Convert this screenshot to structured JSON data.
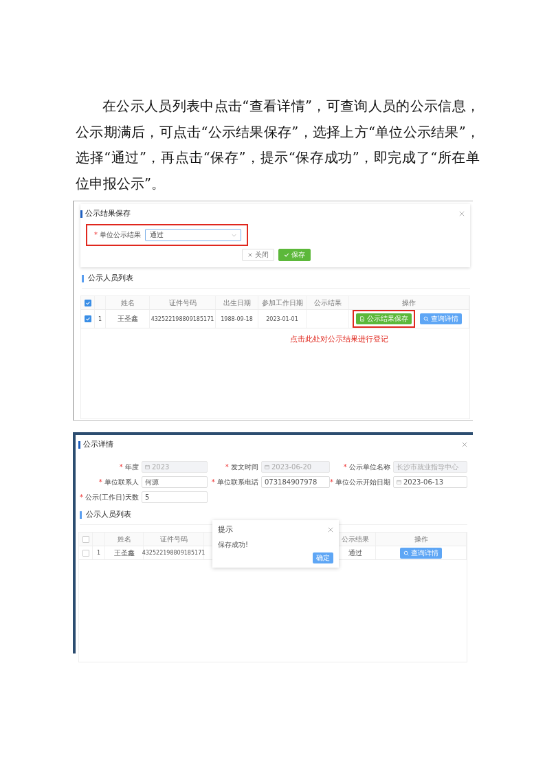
{
  "paragraph": "在公示人员列表中点击“查看详情”，可查询人员的公示信息，公示期满后，可点击“公示结果保存”，选择上方“单位公示结果”，选择“通过”，再点击“保存”，提示“保存成功”，即完成了“所在单位申报公示”。",
  "screenshot_1": {
    "dialog": {
      "title": "公示结果保存",
      "field": {
        "label": "单位公示结果",
        "required_mark": "*",
        "value": "通过",
        "highlighted": true
      },
      "buttons": [
        {
          "label": "关闭",
          "kind": "close"
        },
        {
          "label": "保存",
          "kind": "save"
        }
      ]
    },
    "section_title": "公示人员列表",
    "table": {
      "all_checked": true,
      "columns": [
        "姓名",
        "证件号码",
        "出生日期",
        "参加工作日期",
        "公示结果",
        "操作"
      ],
      "rows": [
        {
          "checked": true,
          "index": "1",
          "name": "王圣鑫",
          "id_number": "432522198809185171",
          "birth_date": "1988-09-18",
          "work_date": "2023-01-01",
          "actions": [
            {
              "label": "公示结果保存",
              "kind": "save",
              "highlighted": true
            },
            {
              "label": "查询详情",
              "kind": "search",
              "highlighted": false
            }
          ]
        }
      ]
    },
    "annotation": "点击此处对公示结果进行登记"
  },
  "screenshot_2": {
    "dialog": {
      "title": "公示详情",
      "fields": [
        {
          "label": "年度",
          "required_mark": "*",
          "value": "2023",
          "kind": "date",
          "disabled": true
        },
        {
          "label": "发文时间",
          "required_mark": "*",
          "value": "2023-06-20",
          "kind": "date",
          "disabled": true
        },
        {
          "label": "公示单位名称",
          "required_mark": "*",
          "value": "长沙市就业指导中心",
          "kind": "text",
          "disabled": true
        },
        {
          "label": "单位联系人",
          "required_mark": "*",
          "value": "何源",
          "kind": "text",
          "disabled": false
        },
        {
          "label": "单位联系电话",
          "required_mark": "*",
          "value": "073184907978",
          "kind": "text",
          "disabled": false
        },
        {
          "label": "单位公示开始日期",
          "required_mark": "*",
          "value": "2023-06-13",
          "kind": "date",
          "disabled": false
        },
        {
          "label": "公示(工作日)天数",
          "required_mark": "*",
          "value": "5",
          "kind": "text",
          "disabled": false
        }
      ]
    },
    "section_title": "公示人员列表",
    "table": {
      "all_checked": false,
      "columns": [
        "姓名",
        "证件号码",
        "公示结果",
        "操作"
      ],
      "rows": [
        {
          "checked": false,
          "index": "1",
          "name": "王圣鑫",
          "id_number": "432522198809185171",
          "result": "通过",
          "actions": [
            {
              "label": "查询详情",
              "kind": "search"
            }
          ]
        }
      ]
    },
    "message_box": {
      "title": "提示",
      "message": "保存成功!",
      "button": "确定"
    }
  }
}
